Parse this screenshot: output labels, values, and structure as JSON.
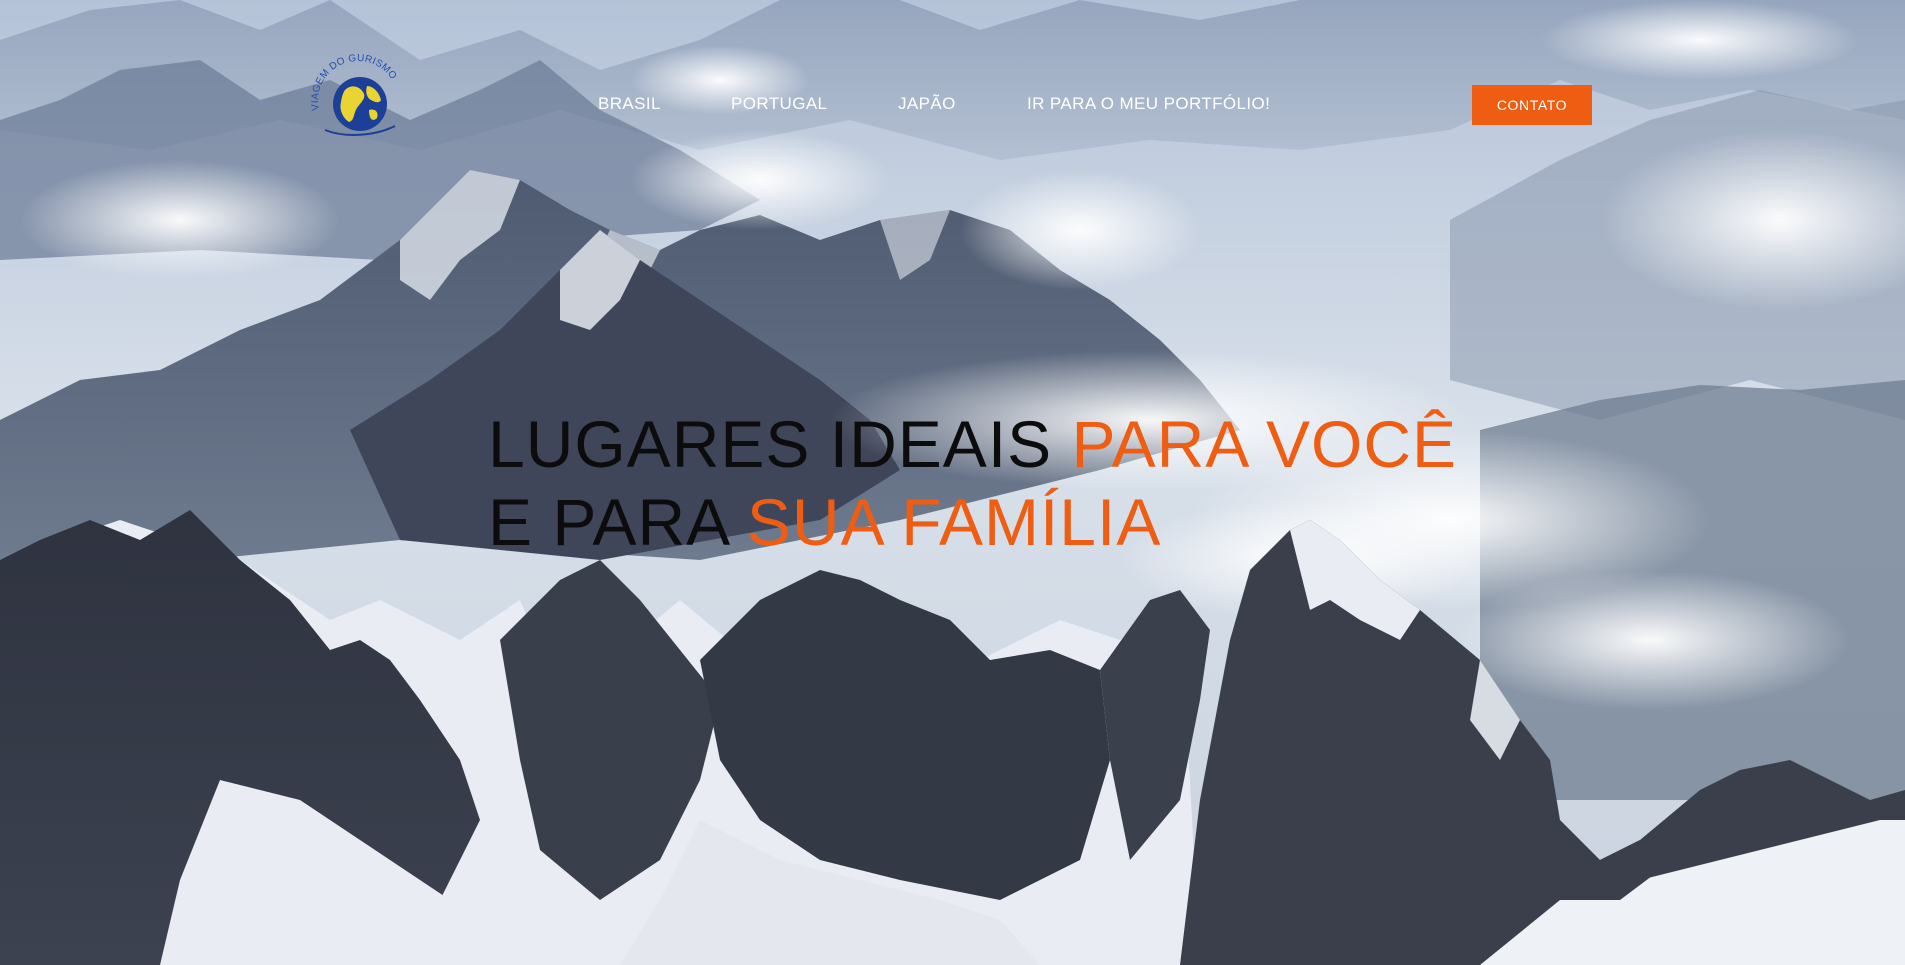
{
  "brand": {
    "logo_text": "VIAGEM DO GURISMO",
    "accent_color": "#ee5d12",
    "text_dark_color": "#0c0c0c"
  },
  "nav": {
    "items": [
      {
        "label": "BRASIL"
      },
      {
        "label": "PORTUGAL"
      },
      {
        "label": "JAPÃO"
      },
      {
        "label": "IR PARA O MEU PORTFÓLIO!"
      }
    ],
    "cta_label": "CONTATO"
  },
  "hero": {
    "line1_dark": "LUGARES IDEAIS ",
    "line1_accent": "PARA VOCÊ",
    "line2_dark": "E PARA ",
    "line2_accent": "SUA FAMÍLIA",
    "background_icon": "snowy-mountains-image"
  }
}
